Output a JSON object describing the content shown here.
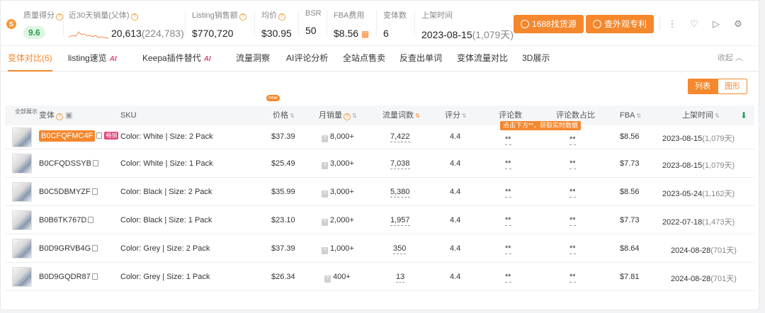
{
  "stats": {
    "quality": {
      "label": "质量得分",
      "value": "9.6"
    },
    "sales30": {
      "label": "近30天销量(父体)",
      "value": "20,613",
      "parent": "(224,783)"
    },
    "revenue": {
      "label": "Listing销售额",
      "value": "$770,720"
    },
    "avg_price": {
      "label": "均价",
      "value": "$30.95"
    },
    "bsr": {
      "label": "BSR",
      "value": "50"
    },
    "fba": {
      "label": "FBA费用",
      "value": "$8.56"
    },
    "variants": {
      "label": "变体数",
      "value": "6"
    },
    "launch": {
      "label": "上架时间",
      "value": "2023-08-15",
      "days": "(1,079天)"
    }
  },
  "buttons": {
    "source": "1688找货源",
    "patent": "查外观专利"
  },
  "tabs": [
    {
      "label": "变体对比(6)"
    },
    {
      "label": "listing速览"
    },
    {
      "label": "Keepa插件替代"
    },
    {
      "label": "流量洞察"
    },
    {
      "label": "AI评论分析"
    },
    {
      "label": "全站点售卖"
    },
    {
      "label": "反查出单词"
    },
    {
      "label": "变体流量对比"
    },
    {
      "label": "3D展示"
    }
  ],
  "ai_tag": "AI",
  "new_tag": "new",
  "collapse": "收起",
  "view_toggle": {
    "list": "列表",
    "chart": "图形"
  },
  "table": {
    "headers": {
      "show_all": "全部展示",
      "variant": "变体",
      "sku": "SKU",
      "price": "价格",
      "monthly_sales": "月销量",
      "traffic_words": "流量词数",
      "rating": "评分",
      "reviews": "评论数",
      "review_share": "评论数占比",
      "fba": "FBA",
      "launch": "上架时间"
    },
    "current_tag": "畅销",
    "hint": "点击下方**，获取实时数据",
    "rows": [
      {
        "asin": "B0CFQFMC4F",
        "sku": "Color: White | Size: 2 Pack",
        "price": "$37.39",
        "sales": "8,000+",
        "words": "7,422",
        "rating": "4.4",
        "reviews": "**",
        "share": "**",
        "fba": "$8.56",
        "date": "2023-08-15",
        "days": "(1,079天)"
      },
      {
        "asin": "B0CFQDSSYB",
        "sku": "Color: White | Size: 1 Pack",
        "price": "$25.49",
        "sales": "3,000+",
        "words": "7,038",
        "rating": "4.4",
        "reviews": "**",
        "share": "**",
        "fba": "$7.73",
        "date": "2023-08-15",
        "days": "(1,079天)"
      },
      {
        "asin": "B0C5DBMYZF",
        "sku": "Color: Black | Size: 2 Pack",
        "price": "$35.99",
        "sales": "3,000+",
        "words": "5,380",
        "rating": "4.4",
        "reviews": "**",
        "share": "**",
        "fba": "$8.56",
        "date": "2023-05-24",
        "days": "(1,162天)"
      },
      {
        "asin": "B0B6TK767D",
        "sku": "Color: Black | Size: 1 Pack",
        "price": "$23.10",
        "sales": "2,000+",
        "words": "1,957",
        "rating": "4.4",
        "reviews": "**",
        "share": "**",
        "fba": "$7.73",
        "date": "2022-07-18",
        "days": "(1,473天)"
      },
      {
        "asin": "B0D9GRVB4G",
        "sku": "Color: Grey | Size: 2 Pack",
        "price": "$37.39",
        "sales": "1,000+",
        "words": "350",
        "rating": "4.4",
        "reviews": "**",
        "share": "**",
        "fba": "$8.64",
        "date": "2024-08-28",
        "days": "(701天)"
      },
      {
        "asin": "B0D9GQDR87",
        "sku": "Color: Grey | Size: 1 Pack",
        "price": "$26.34",
        "sales": "400+",
        "words": "13",
        "rating": "4.4",
        "reviews": "**",
        "share": "**",
        "fba": "$7.81",
        "date": "2024-08-28",
        "days": "(701天)"
      }
    ]
  }
}
